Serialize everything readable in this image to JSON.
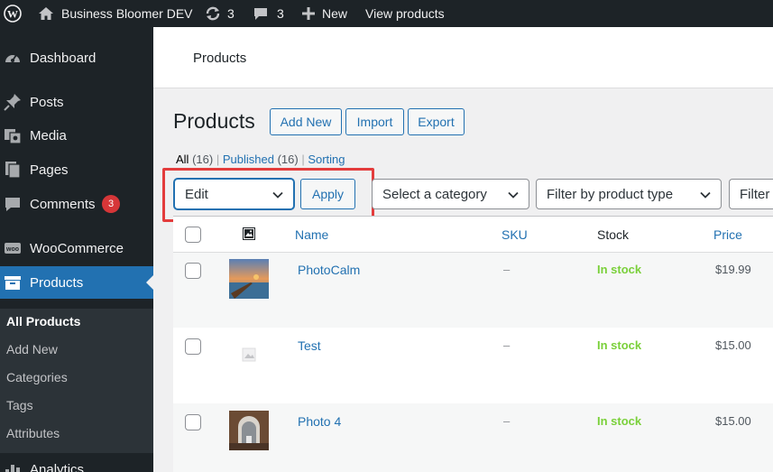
{
  "admin_bar": {
    "site_name": "Business Bloomer DEV",
    "updates_count": "3",
    "comments_count": "3",
    "new_label": "New",
    "view_label": "View products"
  },
  "sidebar": {
    "items": [
      {
        "label": "Dashboard",
        "icon": "dashboard-icon"
      },
      {
        "label": "Posts",
        "icon": "pin-icon"
      },
      {
        "label": "Media",
        "icon": "media-icon"
      },
      {
        "label": "Pages",
        "icon": "pages-icon"
      },
      {
        "label": "Comments",
        "icon": "comment-icon",
        "badge": "3"
      },
      {
        "label": "WooCommerce",
        "icon": "woo-icon"
      },
      {
        "label": "Products",
        "icon": "archive-icon",
        "current": true
      },
      {
        "label": "Analytics",
        "icon": "chart-icon"
      }
    ],
    "submenu": [
      "All Products",
      "Add New",
      "Categories",
      "Tags",
      "Attributes"
    ]
  },
  "header": {
    "title": "Products"
  },
  "page": {
    "title": "Products",
    "buttons": [
      "Add New",
      "Import",
      "Export"
    ]
  },
  "views": {
    "all_label": "All",
    "all_count": "(16)",
    "published_label": "Published",
    "published_count": "(16)",
    "sorting_label": "Sorting"
  },
  "filters": {
    "bulk_action": "Edit",
    "apply": "Apply",
    "category": "Select a category",
    "product_type": "Filter by product type",
    "stock": "Filter"
  },
  "table": {
    "columns": {
      "name": "Name",
      "sku": "SKU",
      "stock": "Stock",
      "price": "Price"
    },
    "rows": [
      {
        "name": "PhotoCalm",
        "sku": "–",
        "stock": "In stock",
        "price": "$19.99",
        "thumb": "pier-photo"
      },
      {
        "name": "Test",
        "sku": "–",
        "stock": "In stock",
        "price": "$15.00",
        "thumb": "placeholder"
      },
      {
        "name": "Photo 4",
        "sku": "–",
        "stock": "In stock",
        "price": "$15.00",
        "thumb": "arch-photo"
      }
    ]
  },
  "colors": {
    "admin_dark": "#1d2327",
    "accent": "#2271b1",
    "in_stock": "#7ad03a",
    "highlight": "#e33c3c"
  }
}
